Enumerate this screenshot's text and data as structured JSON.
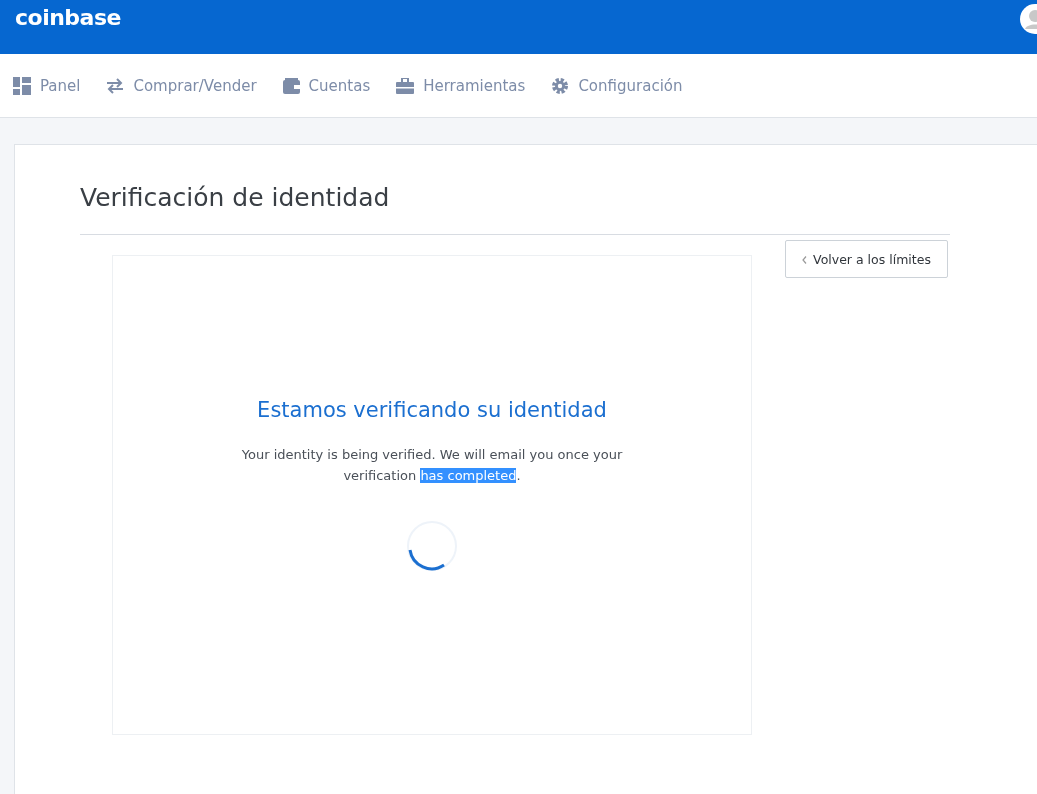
{
  "header": {
    "logo": "coinbase"
  },
  "nav": [
    {
      "label": "Panel"
    },
    {
      "label": "Comprar/Vender"
    },
    {
      "label": "Cuentas"
    },
    {
      "label": "Herramientas"
    },
    {
      "label": "Configuración"
    }
  ],
  "page": {
    "title": "Verificación de identidad",
    "back_button": "Volver a los límites"
  },
  "status": {
    "heading": "Estamos verificando su identidad",
    "message": [
      {
        "text": "Your identity is being verified. We will email you once your verification ",
        "selected": false
      },
      {
        "text": "has completed",
        "selected": true
      },
      {
        "text": ".",
        "selected": false
      }
    ]
  }
}
